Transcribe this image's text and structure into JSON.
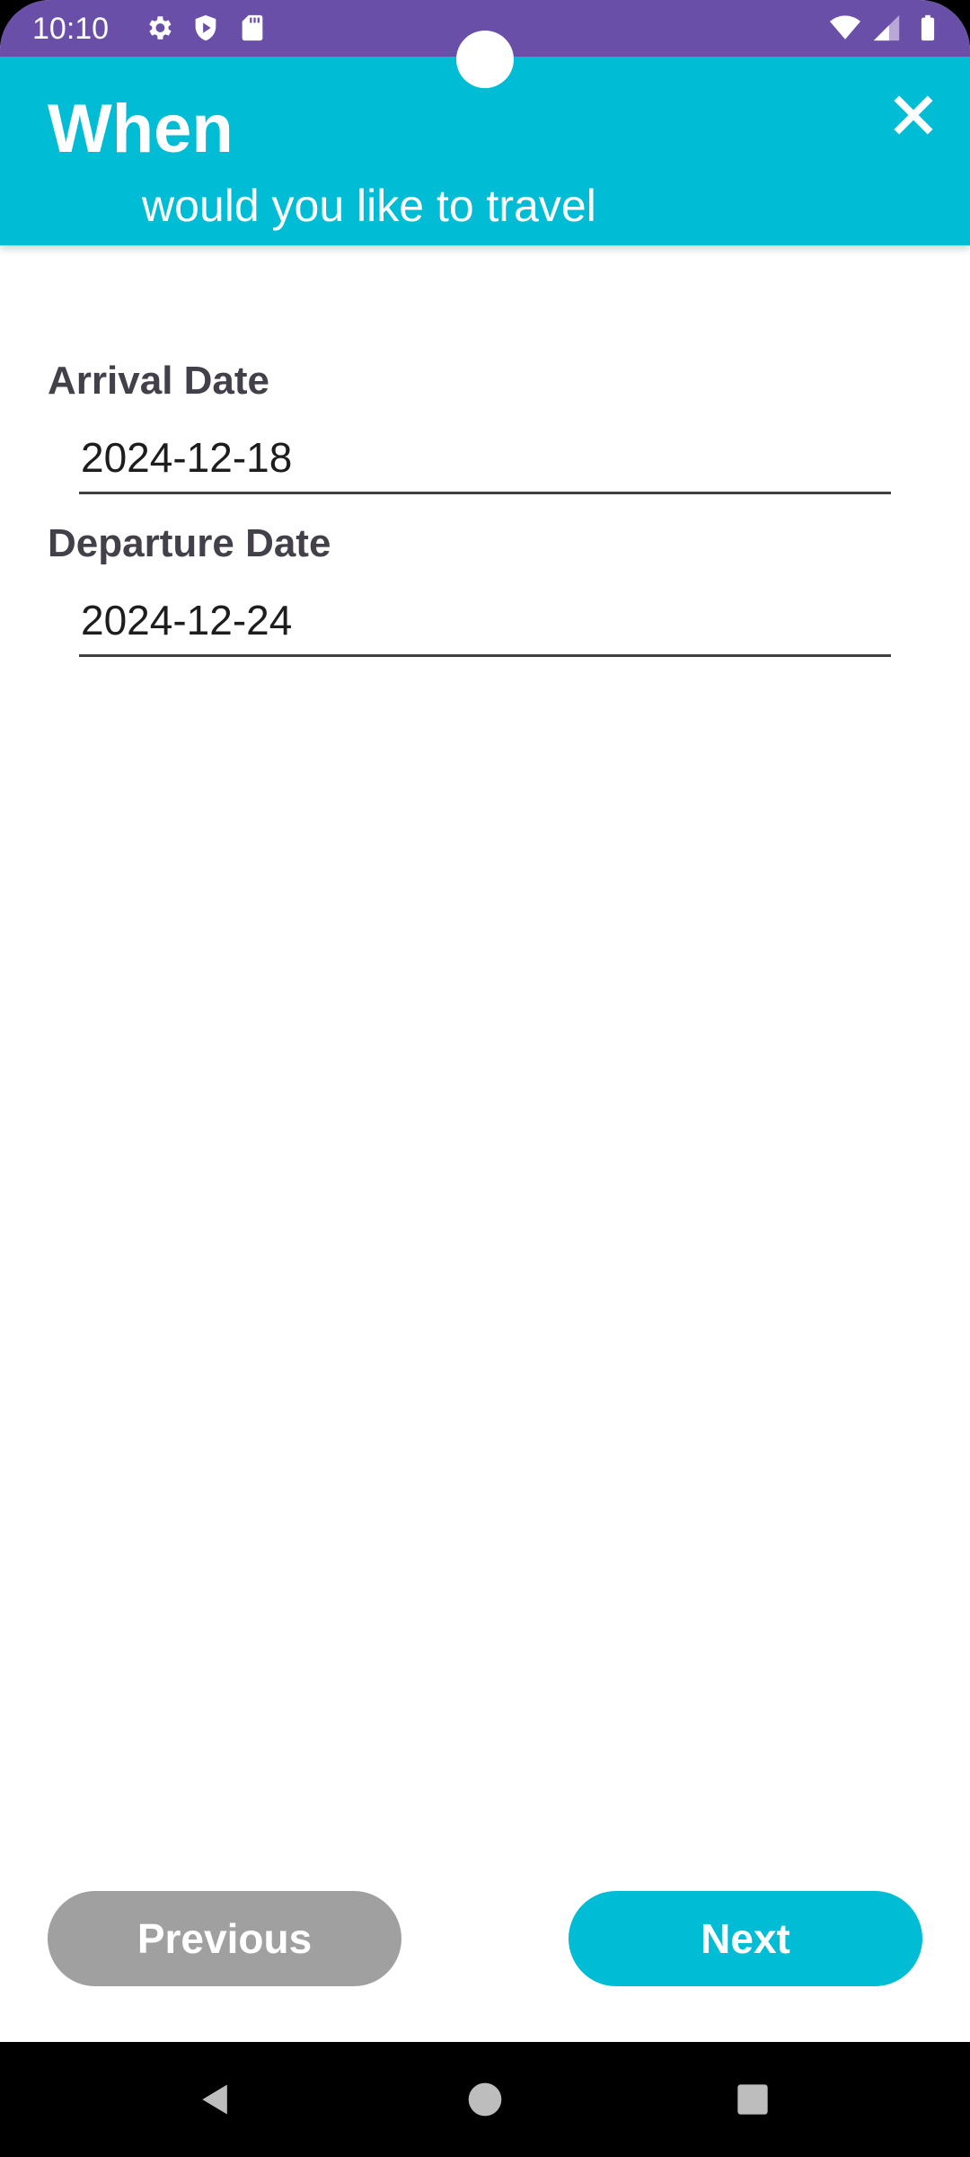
{
  "status_bar": {
    "time": "10:10",
    "left_icons": [
      "gear-icon",
      "shield-play-icon",
      "sd-card-icon"
    ],
    "right_icons": [
      "wifi-icon",
      "cell-signal-icon",
      "battery-icon"
    ],
    "color": "#6a4fa8"
  },
  "header": {
    "title": "When",
    "subtitle": "would you like to travel",
    "close_icon": "close-icon",
    "color": "#00bcd4"
  },
  "form": {
    "arrival": {
      "label": "Arrival Date",
      "value": "2024-12-18"
    },
    "departure": {
      "label": "Departure Date",
      "value": "2024-12-24"
    }
  },
  "buttons": {
    "previous": "Previous",
    "next": "Next",
    "previous_color": "#a0a0a0",
    "next_color": "#00bcd4"
  },
  "nav_bar": {
    "icons": [
      "back-icon",
      "home-icon",
      "recents-icon"
    ]
  }
}
